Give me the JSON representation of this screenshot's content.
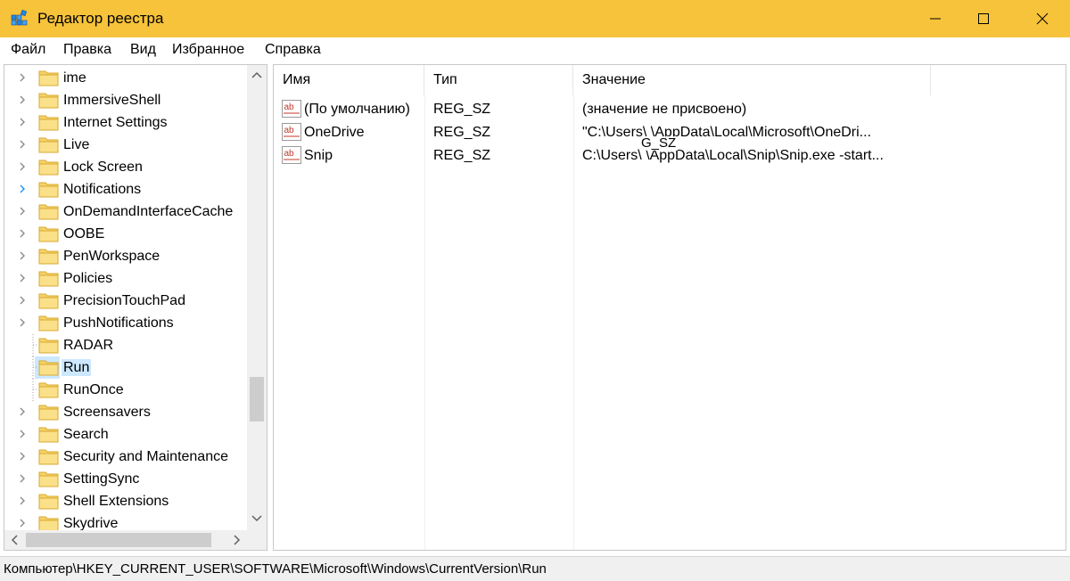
{
  "window": {
    "title": "Редактор реестра",
    "accent": "#f7c33a"
  },
  "menu": [
    "Файл",
    "Правка",
    "Вид",
    "Избранное",
    "Справка"
  ],
  "tree": {
    "items": [
      {
        "label": "ime",
        "expandable": true
      },
      {
        "label": "ImmersiveShell",
        "expandable": true
      },
      {
        "label": "Internet Settings",
        "expandable": true
      },
      {
        "label": "Live",
        "expandable": true
      },
      {
        "label": "Lock Screen",
        "expandable": true
      },
      {
        "label": "Notifications",
        "expandable": true,
        "hover": true
      },
      {
        "label": "OnDemandInterfaceCache",
        "expandable": true
      },
      {
        "label": "OOBE",
        "expandable": true
      },
      {
        "label": "PenWorkspace",
        "expandable": true
      },
      {
        "label": "Policies",
        "expandable": true
      },
      {
        "label": "PrecisionTouchPad",
        "expandable": true
      },
      {
        "label": "PushNotifications",
        "expandable": true
      },
      {
        "label": "RADAR",
        "expandable": false
      },
      {
        "label": "Run",
        "expandable": false,
        "selected": true
      },
      {
        "label": "RunOnce",
        "expandable": false
      },
      {
        "label": "Screensavers",
        "expandable": true
      },
      {
        "label": "Search",
        "expandable": true
      },
      {
        "label": "Security and Maintenance",
        "expandable": true
      },
      {
        "label": "SettingSync",
        "expandable": true
      },
      {
        "label": "Shell Extensions",
        "expandable": true
      },
      {
        "label": "Skydrive",
        "expandable": true
      }
    ]
  },
  "list": {
    "headers": {
      "name": "Имя",
      "type": "Тип",
      "value": "Значение"
    },
    "rows": [
      {
        "name": "(По умолчанию)",
        "type": "REG_SZ",
        "value": "(значение не присвоено)"
      },
      {
        "name": "OneDrive",
        "type": "REG_SZ",
        "value": "\"C:\\Users\\   \\AppData\\Local\\Microsoft\\OneDri..."
      },
      {
        "name": "Snip",
        "type": "REG_SZ",
        "value": "C:\\Users\\   \\AppData\\Local\\Snip\\Snip.exe -start..."
      }
    ],
    "drag_ghost": "G_SZ"
  },
  "status": {
    "path": "Компьютер\\HKEY_CURRENT_USER\\SOFTWARE\\Microsoft\\Windows\\CurrentVersion\\Run"
  },
  "icons": {
    "app": "registry-icon",
    "folder": "folder-icon",
    "string_value": "reg-sz-icon"
  }
}
